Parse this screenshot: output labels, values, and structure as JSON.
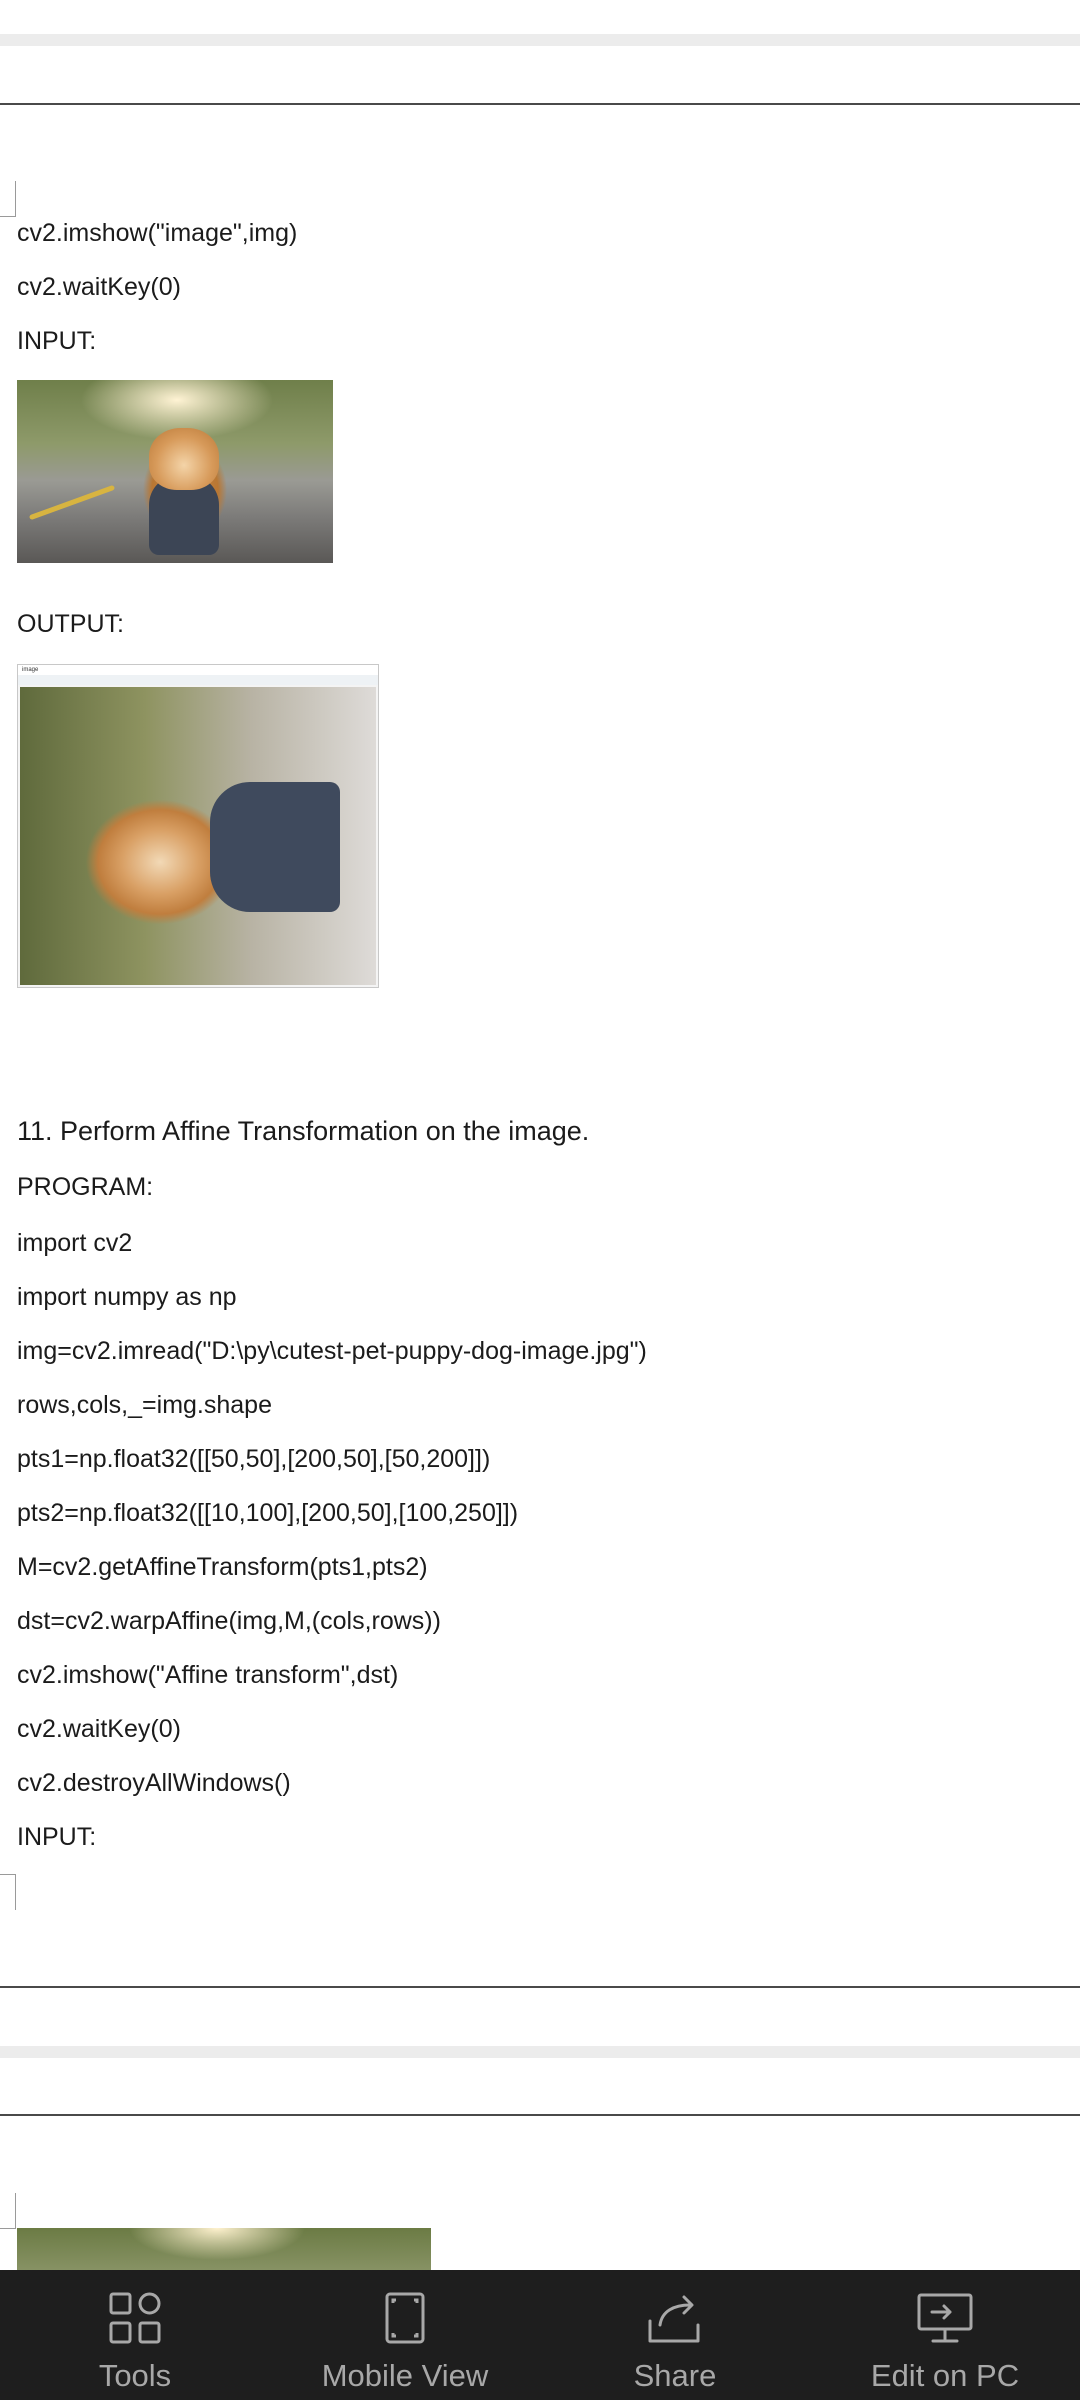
{
  "document": {
    "top_lines": [
      "cv2.imshow(\"image\",img)",
      "cv2.waitKey(0)",
      "INPUT:"
    ],
    "output_label": "OUTPUT:",
    "heading": "11. Perform Affine Transformation on the image.",
    "program_label": "PROGRAM:",
    "code_lines": [
      "import cv2",
      "import numpy as np",
      "img=cv2.imread(\"D:\\py\\cutest-pet-puppy-dog-image.jpg\")",
      "rows,cols,_=img.shape",
      "pts1=np.float32([[50,50],[200,50],[50,200]])",
      "pts2=np.float32([[10,100],[200,50],[100,250]])",
      "M=cv2.getAffineTransform(pts1,pts2)",
      "dst=cv2.warpAffine(img,M,(cols,rows))",
      "cv2.imshow(\"Affine transform\",dst)",
      "cv2.waitKey(0)",
      "cv2.destroyAllWindows()"
    ],
    "input_label_2": "INPUT:"
  },
  "output_window": {
    "title": "image"
  },
  "toolbar": {
    "items": [
      {
        "label": "Tools",
        "icon": "tools-icon"
      },
      {
        "label": "Mobile View",
        "icon": "mobile-view-icon"
      },
      {
        "label": "Share",
        "icon": "share-icon"
      },
      {
        "label": "Edit on PC",
        "icon": "edit-on-pc-icon"
      }
    ]
  }
}
